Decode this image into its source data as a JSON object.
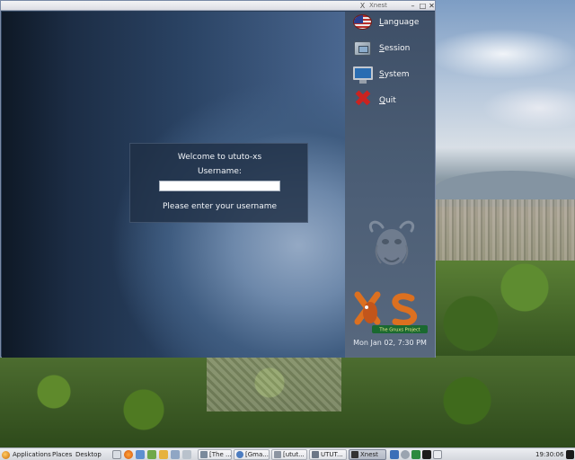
{
  "xnest_window": {
    "title": "Xnest",
    "min_glyph": "–",
    "max_glyph": "□",
    "close_glyph": "✕",
    "logo_glyph": "X"
  },
  "gdm_menu": {
    "items": [
      {
        "label": "Language",
        "accel": "L",
        "rest": "anguage",
        "icon": "language-flag-icon"
      },
      {
        "label": "Session",
        "accel": "S",
        "rest": "ession",
        "icon": "session-icon"
      },
      {
        "label": "System",
        "accel": "S",
        "rest": "ystem",
        "icon": "system-monitor-icon"
      },
      {
        "label": "Quit",
        "accel": "Q",
        "rest": "uit",
        "icon": "quit-x-icon"
      }
    ],
    "quit_glyph": "✖",
    "clock": "Mon Jan 02,  7:30 PM",
    "logo_text": "The Gnuxs Project"
  },
  "login": {
    "welcome": "Welcome to ututo-xs",
    "username_label": "Username:",
    "username_value": "",
    "hint": "Please enter your username"
  },
  "taskbar": {
    "menus": [
      "Applications",
      "Places",
      "Desktop"
    ],
    "tasks": [
      {
        "label": "[The ...",
        "active": false
      },
      {
        "label": "[Gma...",
        "active": false
      },
      {
        "label": "[utut...",
        "active": false
      },
      {
        "label": "UTUT...",
        "active": false
      },
      {
        "label": "Xnest",
        "active": true
      }
    ],
    "time": "19:30:06"
  },
  "colors": {
    "accent": "#2b4465",
    "quit_red": "#d0231f",
    "panel_gray": "#4f6178"
  }
}
